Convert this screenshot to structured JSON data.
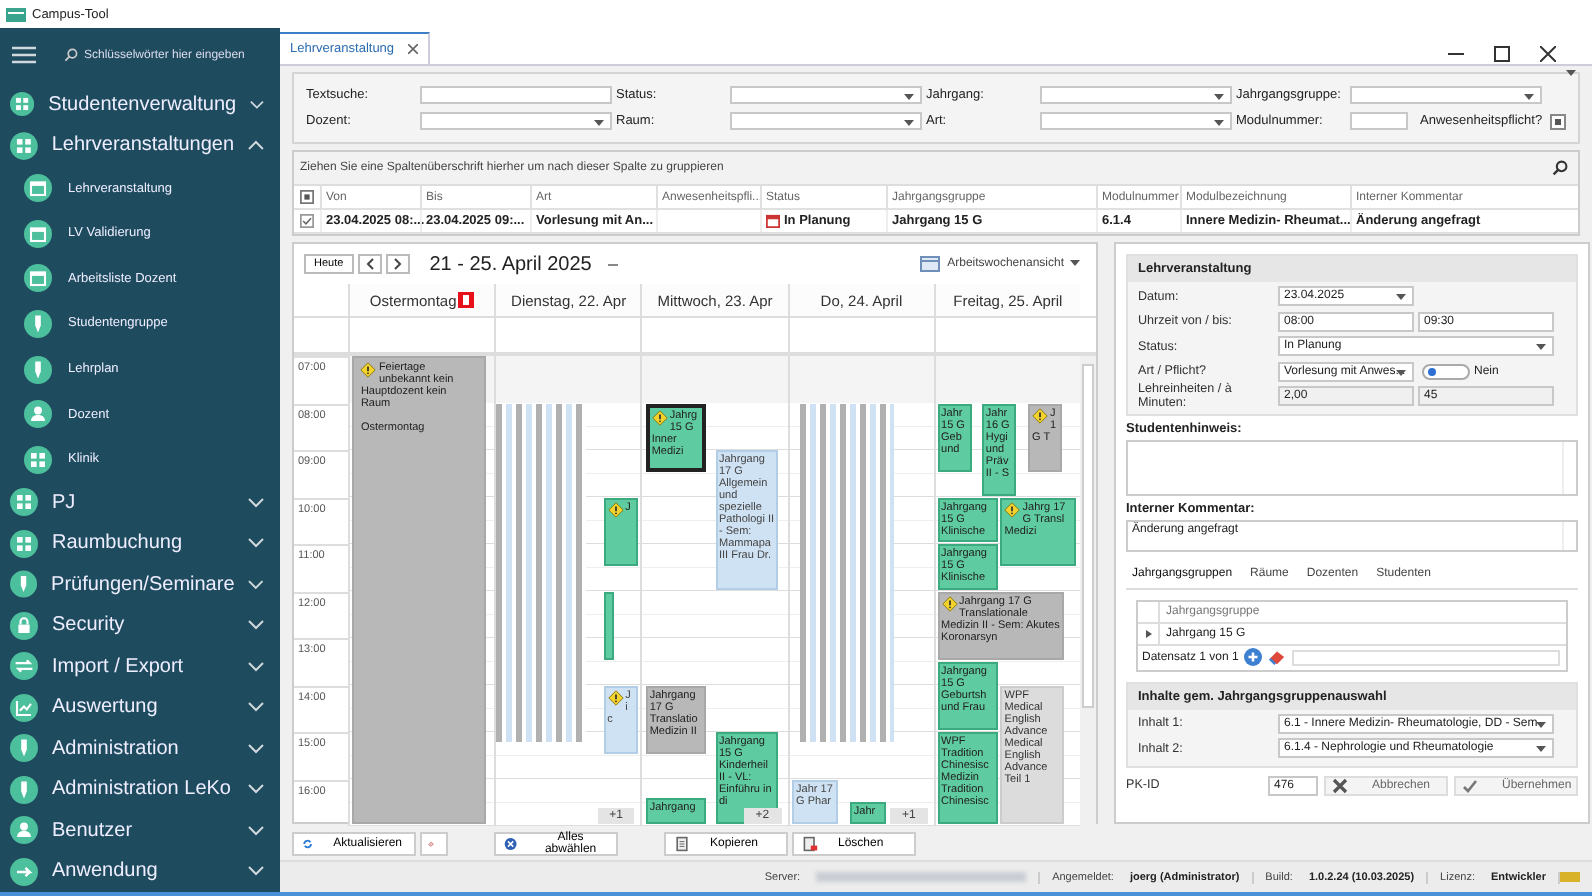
{
  "window": {
    "title": "Campus-Tool"
  },
  "sidebar": {
    "search_placeholder": "Schlüsselwörter hier eingeben",
    "items": [
      {
        "label": "Studentenverwaltung",
        "expanded": false
      },
      {
        "label": "Lehrveranstaltungen",
        "expanded": true,
        "children": [
          {
            "label": "Lehrveranstaltung"
          },
          {
            "label": "LV Validierung"
          },
          {
            "label": "Arbeitsliste Dozent"
          },
          {
            "label": "Studentengruppe"
          },
          {
            "label": "Lehrplan"
          },
          {
            "label": "Dozent"
          },
          {
            "label": "Klinik"
          }
        ]
      },
      {
        "label": "PJ",
        "expanded": false
      },
      {
        "label": "Raumbuchung",
        "expanded": false
      },
      {
        "label": "Prüfungen/Seminare",
        "expanded": false
      },
      {
        "label": "Security",
        "expanded": false
      },
      {
        "label": "Import / Export",
        "expanded": false
      },
      {
        "label": "Auswertung",
        "expanded": false
      },
      {
        "label": "Administration",
        "expanded": false
      },
      {
        "label": "Administration LeKo",
        "expanded": false
      },
      {
        "label": "Benutzer",
        "expanded": false
      },
      {
        "label": "Anwendung",
        "expanded": false
      }
    ]
  },
  "tabs": [
    {
      "label": "Lehrveranstaltung",
      "selected": true
    }
  ],
  "filters": [
    [
      {
        "label": "Textsuche:",
        "kind": "text"
      },
      {
        "label": "Status:",
        "kind": "dropdown"
      },
      {
        "label": "Jahrgang:",
        "kind": "dropdown"
      },
      {
        "label": "Jahrgangsgruppe:",
        "kind": "dropdown"
      }
    ],
    [
      {
        "label": "Dozent:",
        "kind": "dropdown"
      },
      {
        "label": "Raum:",
        "kind": "dropdown"
      },
      {
        "label": "Art:",
        "kind": "dropdown"
      },
      {
        "label": "Modulnummer:",
        "kind": "short"
      },
      {
        "label": "Anwesenheitspflicht?",
        "kind": "checkbox",
        "indeterminate": true
      }
    ]
  ],
  "grid": {
    "group_hint": "Ziehen Sie eine Spaltenüberschrift hierher um nach dieser Spalte zu gruppieren",
    "select_all_indeterminate": true,
    "columns": [
      {
        "label": "Von",
        "kind": "text"
      },
      {
        "label": "Bis",
        "kind": "text"
      },
      {
        "label": "Art",
        "kind": "text"
      },
      {
        "label": "Anwesenheitspfli...",
        "kind": "text"
      },
      {
        "label": "Status",
        "kind": "status"
      },
      {
        "label": "Jahrgangsgruppe",
        "kind": "text"
      },
      {
        "label": "Modulnummer",
        "kind": "text"
      },
      {
        "label": "Modulbezeichnung",
        "kind": "text"
      },
      {
        "label": "Interner Kommentar",
        "kind": "text"
      }
    ],
    "rows": [
      {
        "checked": true,
        "cells": [
          "23.04.2025 08:...",
          "23.04.2025 09:...",
          "Vorlesung mit An...",
          "",
          "In Planung",
          "Jahrgang 15 G",
          "6.1.4",
          "Innere Medizin- Rheumat...",
          "Änderung angefragt"
        ]
      }
    ]
  },
  "calendar": {
    "today_button": "Heute",
    "range": "21 - 25. April 2025",
    "view": "Arbeitswochenansicht",
    "hours": [
      "07:00",
      "08:00",
      "09:00",
      "10:00",
      "11:00",
      "12:00",
      "13:00",
      "14:00",
      "15:00",
      "16:00"
    ],
    "days": [
      {
        "label": "Ostermontag",
        "holiday": true,
        "events": [
          {
            "kind": "holiday",
            "text": "Feiertage unbekannt kein Hauptdozent kein Raum\n\nOstermontag",
            "warning": true,
            "selected": false
          }
        ]
      },
      {
        "label": "Dienstag, 22. Apr",
        "holiday": false,
        "more": "+1",
        "events": [
          {
            "kind": "stripes",
            "warning": false,
            "selected": false
          },
          {
            "kind": "lecture",
            "text": "J",
            "warning": true,
            "selected": false
          },
          {
            "kind": "lecture",
            "warning": false,
            "selected": false
          },
          {
            "kind": "seminar",
            "text": "J i c",
            "warning": true,
            "selected": false
          }
        ]
      },
      {
        "label": "Mittwoch, 23. Apr",
        "holiday": false,
        "more": "+2",
        "events": [
          {
            "kind": "lecture",
            "text": "Jahrg 15 G Inner Medizi",
            "warning": true,
            "selected": true
          },
          {
            "kind": "seminar",
            "text": "Jahrgang 17 G Allgemein und spezielle Pathologi II - Sem: Mammapa III Frau Dr.",
            "warning": false,
            "selected": false
          },
          {
            "kind": "other",
            "text": "Jahrgang 17 G Translatio Medizin II",
            "warning": false,
            "selected": false
          },
          {
            "kind": "lecture",
            "text": "Jahrgang 15 G Kinderheil II - VL: Einführu in di",
            "warning": false,
            "selected": false
          },
          {
            "kind": "lecture",
            "text": "Jahrgang",
            "warning": false,
            "selected": false
          }
        ]
      },
      {
        "label": "Do, 24. April",
        "holiday": false,
        "more": "+1",
        "events": [
          {
            "kind": "stripes",
            "warning": false,
            "selected": false
          },
          {
            "kind": "seminar",
            "text": "Jahr 17 G Phar",
            "warning": false,
            "selected": false
          },
          {
            "kind": "lecture",
            "text": "Jahr",
            "warning": false,
            "selected": false
          }
        ]
      },
      {
        "label": "Freitag, 25. April",
        "holiday": false,
        "events": [
          {
            "kind": "lecture",
            "text": "Jahr 15 G Geb und",
            "warning": false,
            "selected": false
          },
          {
            "kind": "lecture",
            "text": "Jahr 16 G Hygi und Präv II - S",
            "warning": false,
            "selected": false
          },
          {
            "kind": "other",
            "text": "J 1 G T",
            "warning": true,
            "selected": false
          },
          {
            "kind": "lecture",
            "text": "Jahrgang 15 G Klinische",
            "warning": false,
            "selected": false
          },
          {
            "kind": "lecture",
            "text": "Jahrgang 15 G Klinische",
            "warning": false,
            "selected": false
          },
          {
            "kind": "lecture",
            "text": "Jahrg 17 G Transl Medizi",
            "warning": true,
            "selected": false
          },
          {
            "kind": "other",
            "text": "Jahrgang 17 G Translationale Medizin II - Sem: Akutes Koronarsyn",
            "warning": true,
            "selected": false
          },
          {
            "kind": "lecture",
            "text": "Jahrgang 15 G Geburtsh und Frau",
            "warning": false,
            "selected": false
          },
          {
            "kind": "lecture",
            "text": "WPF Tradition Chinesisc Medizin Tradition Chinesisc",
            "warning": false,
            "selected": false
          },
          {
            "kind": "elective",
            "text": "WPF Medical English Advance Medical English Advance Teil 1",
            "warning": false,
            "selected": false
          }
        ]
      }
    ]
  },
  "editor": {
    "title": "Lehrveranstaltung",
    "fields": [
      {
        "label": "Datum:",
        "kind": "dropdown",
        "value": "23.04.2025"
      },
      {
        "label": "Uhrzeit von / bis:",
        "kind": "pair",
        "values": [
          "08:00",
          "09:30"
        ]
      },
      {
        "label": "Status:",
        "kind": "dropdown_wide",
        "value": "In Planung"
      },
      {
        "label": "Art / Pflicht?",
        "kind": "dropdown_toggle",
        "value": "Vorlesung mit Anwes...",
        "on": false,
        "toggle_label": "Nein"
      },
      {
        "label": "Lehreinheiten / à Minuten:",
        "kind": "pair_readonly",
        "values": [
          "2,00",
          "45"
        ]
      }
    ],
    "student_note": {
      "label": "Studentenhinweis:"
    },
    "internal_comment": {
      "label": "Interner Kommentar:",
      "value": "Änderung angefragt"
    },
    "subtabs": [
      {
        "label": "Jahrgangsgruppen",
        "selected": true
      },
      {
        "label": "Räume",
        "selected": false
      },
      {
        "label": "Dozenten",
        "selected": false
      },
      {
        "label": "Studenten",
        "selected": false
      }
    ],
    "subgrid": {
      "column": "Jahrgangsgruppe",
      "rows": [
        "Jahrgang 15 G"
      ],
      "pager": "Datensatz 1 von 1"
    },
    "contents": {
      "title": "Inhalte gem. Jahrgangsgruppenauswahl",
      "fields": [
        {
          "label": "Inhalt 1:",
          "value": "6.1 - Innere Medizin- Rheumatologie, DD - Sem"
        },
        {
          "label": "Inhalt 2:",
          "value": "6.1.4 - Nephrologie und Rheumatologie"
        }
      ]
    },
    "pk_label": "PK-ID",
    "pk_value": "476",
    "buttons": [
      {
        "label": "Abbrechen",
        "kind": "cancel"
      },
      {
        "label": "Übernehmen",
        "kind": "apply"
      }
    ]
  },
  "toolbar": [
    {
      "label": "Aktualisieren",
      "kind": "refresh"
    },
    {
      "kind": "eraser"
    },
    {
      "label": "Alles abwählen",
      "kind": "deselect"
    },
    {
      "label": "Kopieren",
      "kind": "copy"
    },
    {
      "label": "Löschen",
      "kind": "delete"
    }
  ],
  "status_bar": [
    {
      "label": "Server:",
      "redacted": true
    },
    {
      "label": "Angemeldet:",
      "value": "joerg (Administrator)"
    },
    {
      "label": "Build:",
      "value": "1.0.2.24 (10.03.2025)"
    },
    {
      "label": "Lizenz:",
      "value": "Entwickler"
    }
  ]
}
